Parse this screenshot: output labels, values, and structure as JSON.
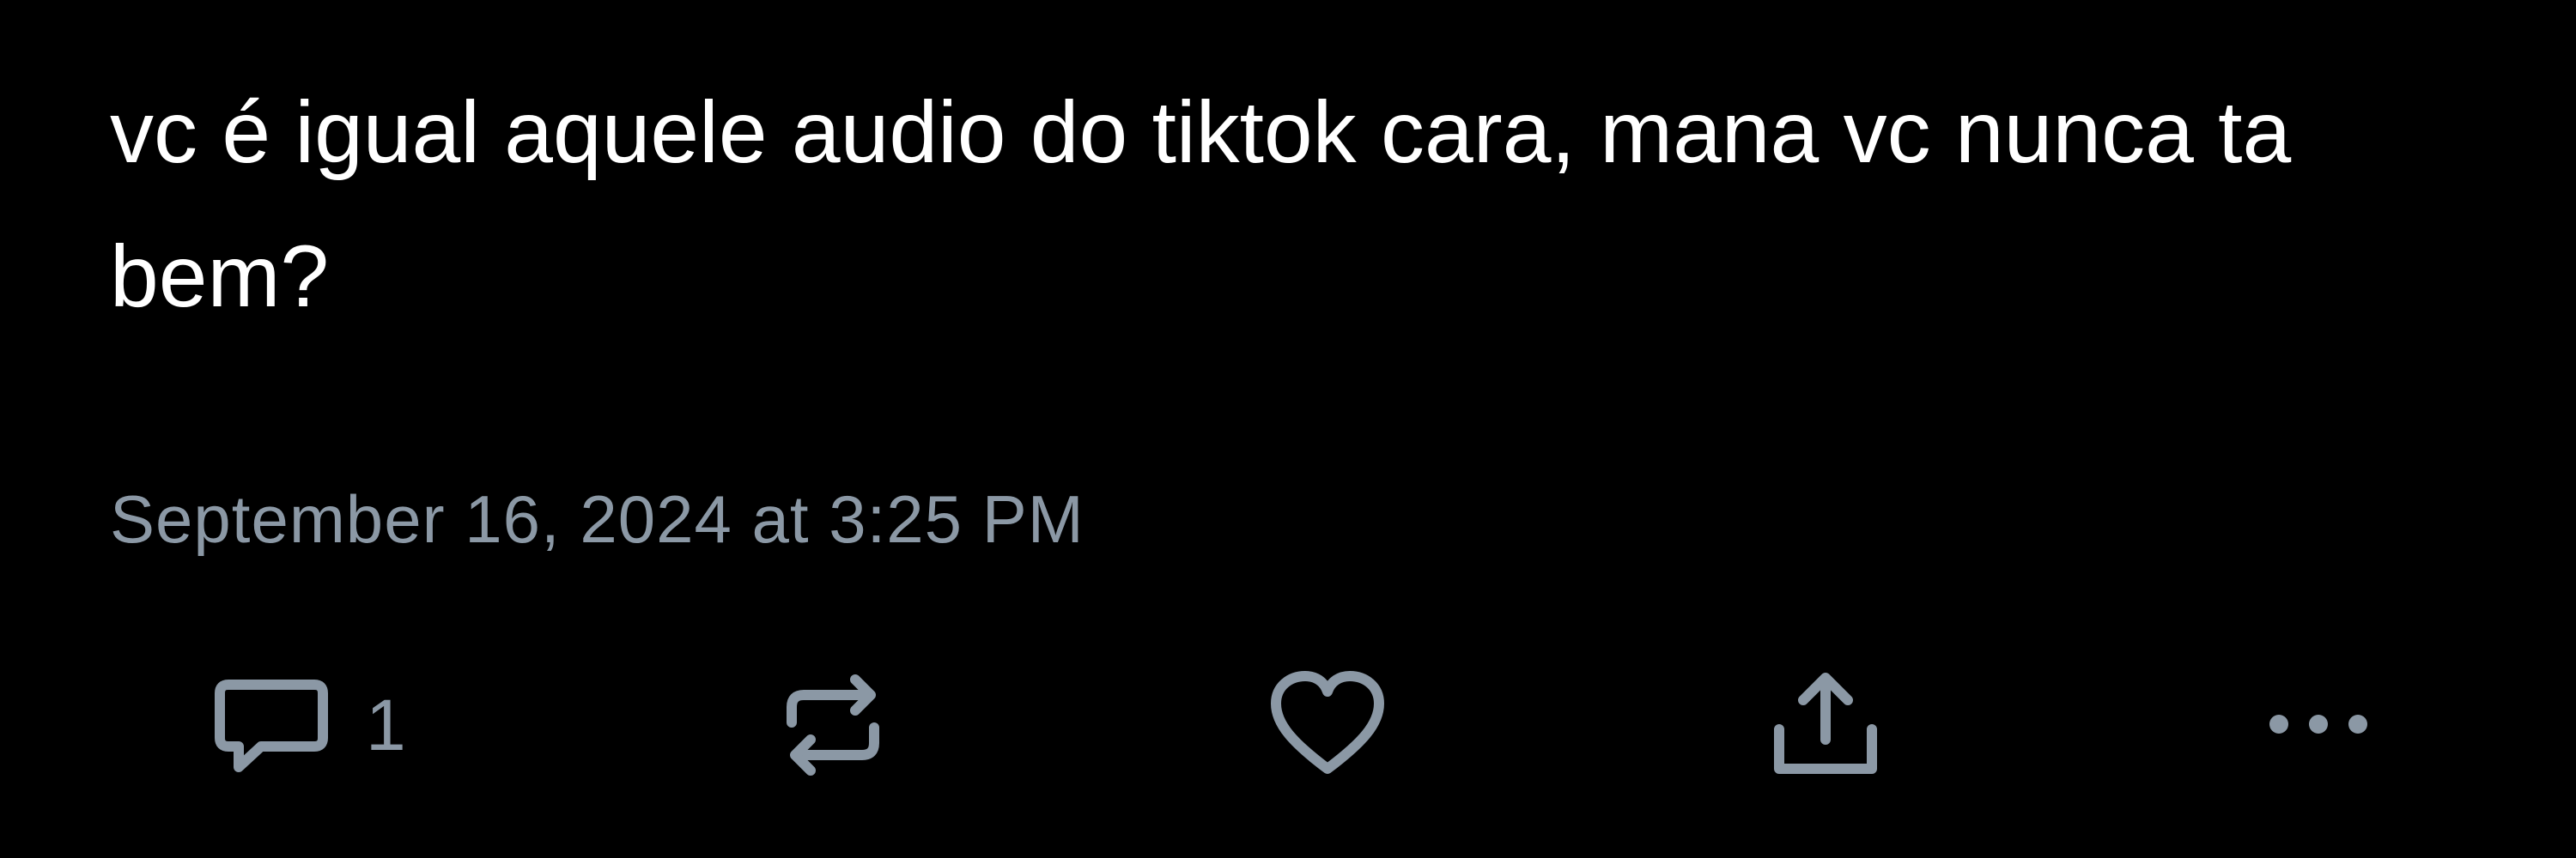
{
  "post": {
    "text": "vc é igual aquele audio do tiktok cara, mana vc nunca ta bem?",
    "timestamp": "September 16, 2024 at 3:25 PM"
  },
  "actions": {
    "reply": {
      "icon": "reply-icon",
      "count": "1"
    },
    "retweet": {
      "icon": "retweet-icon"
    },
    "like": {
      "icon": "heart-icon"
    },
    "share": {
      "icon": "share-icon"
    },
    "more": {
      "icon": "more-icon"
    }
  },
  "colors": {
    "background": "#000000",
    "text": "#ffffff",
    "muted": "#8b98a5"
  }
}
